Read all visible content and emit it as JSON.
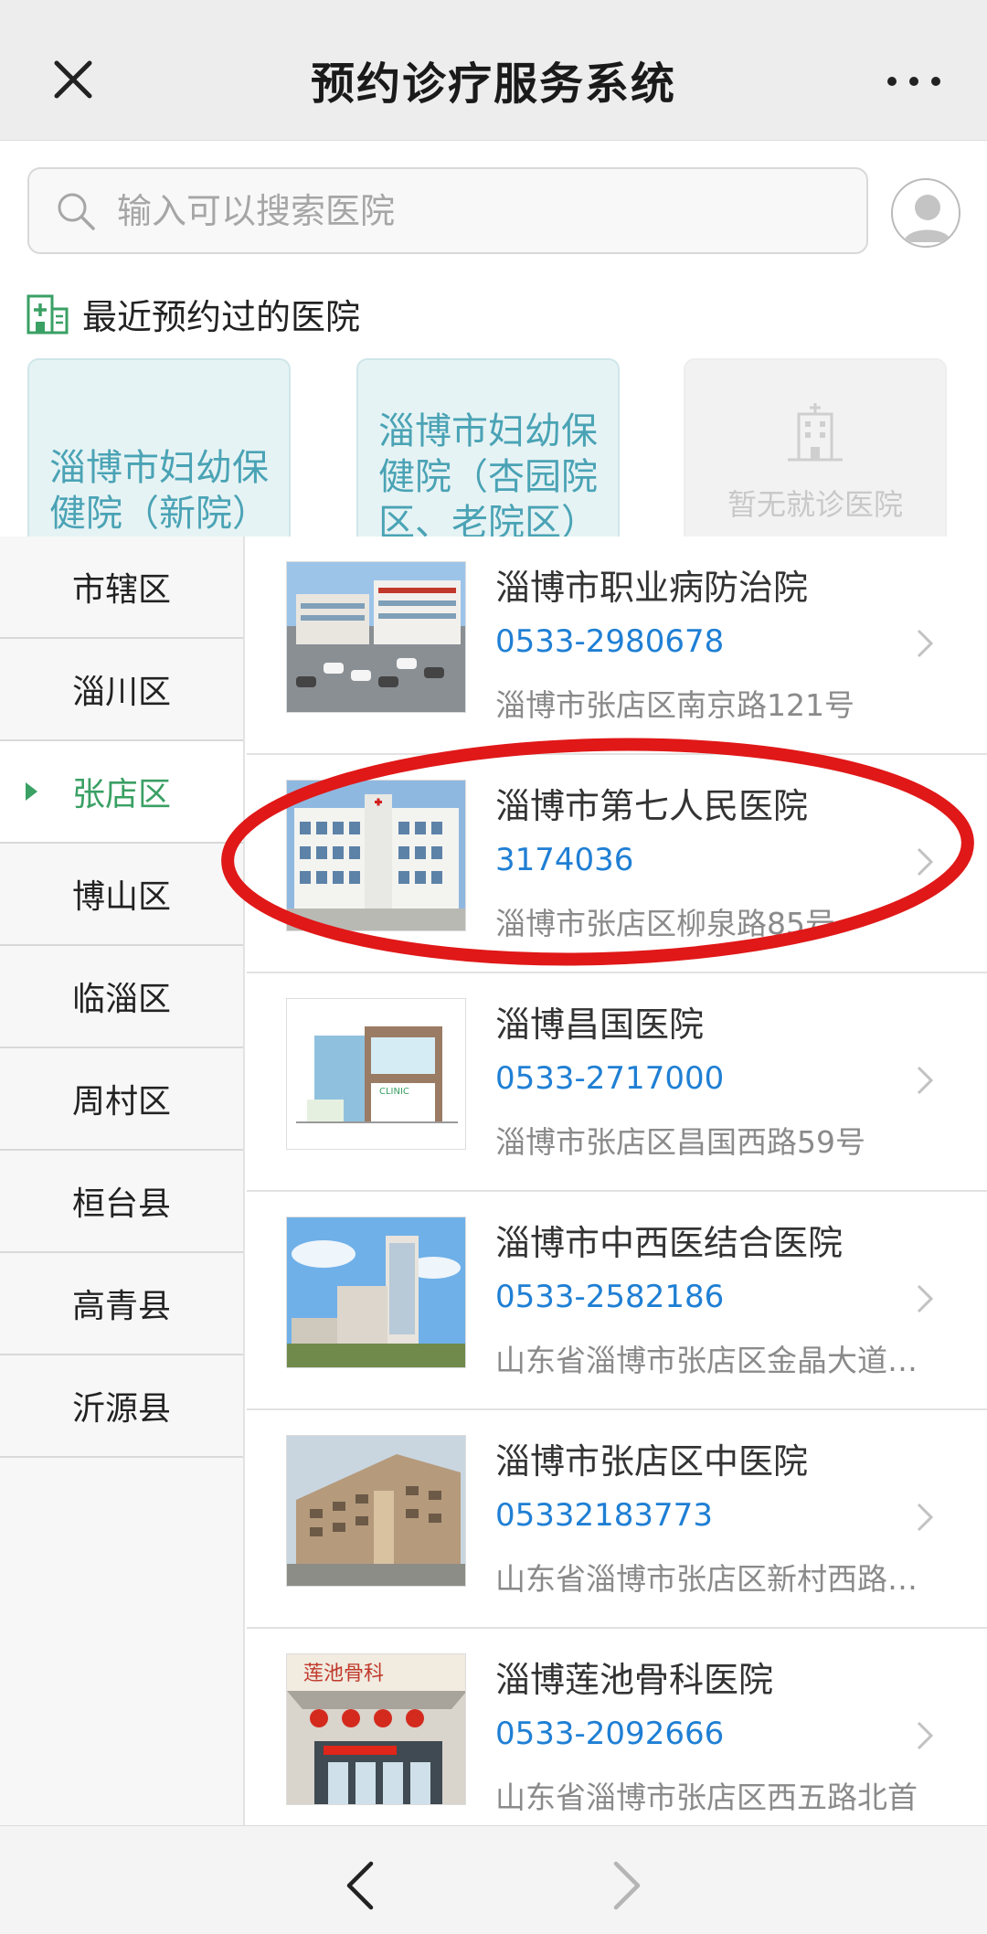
{
  "header": {
    "title": "预约诊疗服务系统",
    "close_icon": "close-icon",
    "more_icon": "more-icon"
  },
  "search": {
    "placeholder": "输入可以搜索医院",
    "icon": "search-icon"
  },
  "recent": {
    "title": "最近预约过的医院",
    "cards": [
      {
        "label": "淄博市妇幼保健院（新院）"
      },
      {
        "label": "淄博市妇幼保健院（杏园院区、老院区）"
      }
    ],
    "empty_label": "暂无就诊医院"
  },
  "regions": [
    {
      "label": "市辖区"
    },
    {
      "label": "淄川区"
    },
    {
      "label": "张店区",
      "active": true
    },
    {
      "label": "博山区"
    },
    {
      "label": "临淄区"
    },
    {
      "label": "周村区"
    },
    {
      "label": "桓台县"
    },
    {
      "label": "高青县"
    },
    {
      "label": "沂源县"
    }
  ],
  "hospitals": [
    {
      "name": "淄博市职业病防治院",
      "phone": "0533-2980678",
      "address": "淄博市张店区南京路121号"
    },
    {
      "name": "淄博市第七人民医院",
      "phone": "3174036",
      "address": "淄博市张店区柳泉路85号"
    },
    {
      "name": "淄博昌国医院",
      "phone": "0533-2717000",
      "address": "淄博市张店区昌国西路59号"
    },
    {
      "name": "淄博市中西医结合医院",
      "phone": "0533-2582186",
      "address": "山东省淄博市张店区金晶大道…"
    },
    {
      "name": "淄博市张店区中医院",
      "phone": "05332183773",
      "address": "山东省淄博市张店区新村西路…"
    },
    {
      "name": "淄博莲池骨科医院",
      "phone": "0533-2092666",
      "address": "山东省淄博市张店区西五路北首"
    }
  ],
  "images": {
    "clinic_sign": "CLINIC",
    "lianchi_sign": "莲池骨科"
  },
  "colors": {
    "accent_green": "#3aa064",
    "phone_blue": "#1f7fd4",
    "annotation_red": "#e01818"
  }
}
